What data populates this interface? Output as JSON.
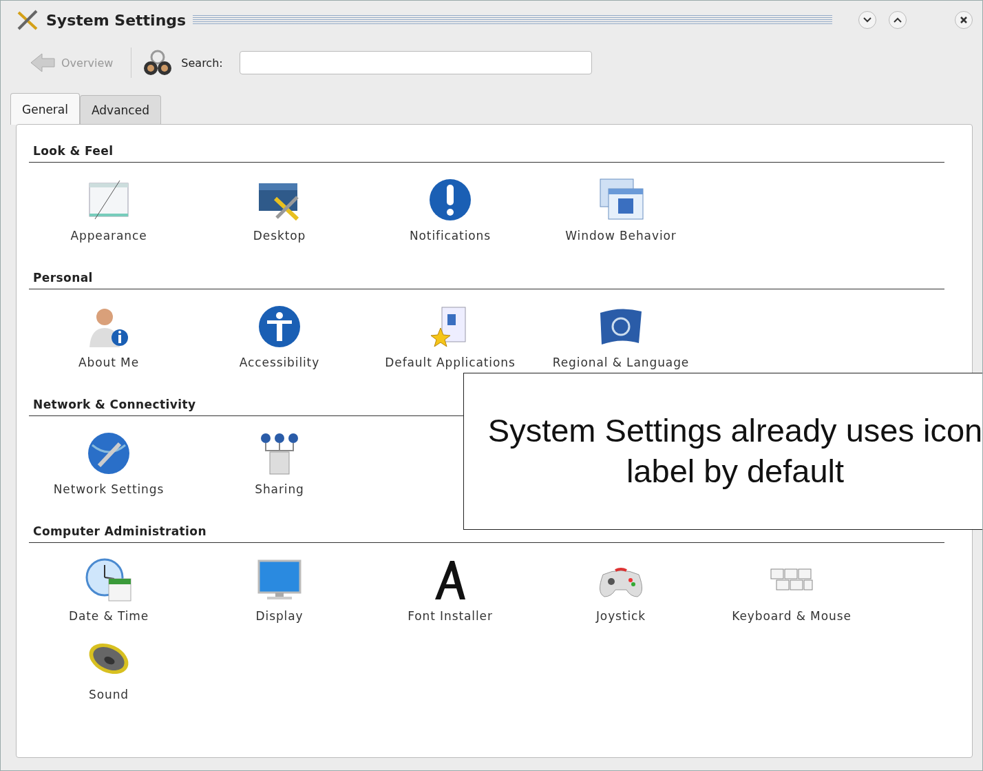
{
  "window": {
    "title": "System Settings"
  },
  "toolbar": {
    "back_label": "Overview",
    "back_disabled": true,
    "search_label": "Search:"
  },
  "tabs": [
    {
      "label": "General",
      "selected": true
    },
    {
      "label": "Advanced",
      "selected": false
    }
  ],
  "sections": [
    {
      "title": "Look & Feel",
      "items": [
        "Appearance",
        "Desktop",
        "Notifications",
        "Window Behavior"
      ]
    },
    {
      "title": "Personal",
      "items": [
        "About Me",
        "Accessibility",
        "Default Applications",
        "Regional & Language"
      ]
    },
    {
      "title": "Network & Connectivity",
      "items": [
        "Network Settings",
        "Sharing"
      ]
    },
    {
      "title": "Computer Administration",
      "items": [
        "Date & Time",
        "Display",
        "Font Installer",
        "Joystick",
        "Keyboard & Mouse",
        "Sound"
      ]
    }
  ],
  "callout": {
    "text": "System Settings already uses icon label by default"
  }
}
